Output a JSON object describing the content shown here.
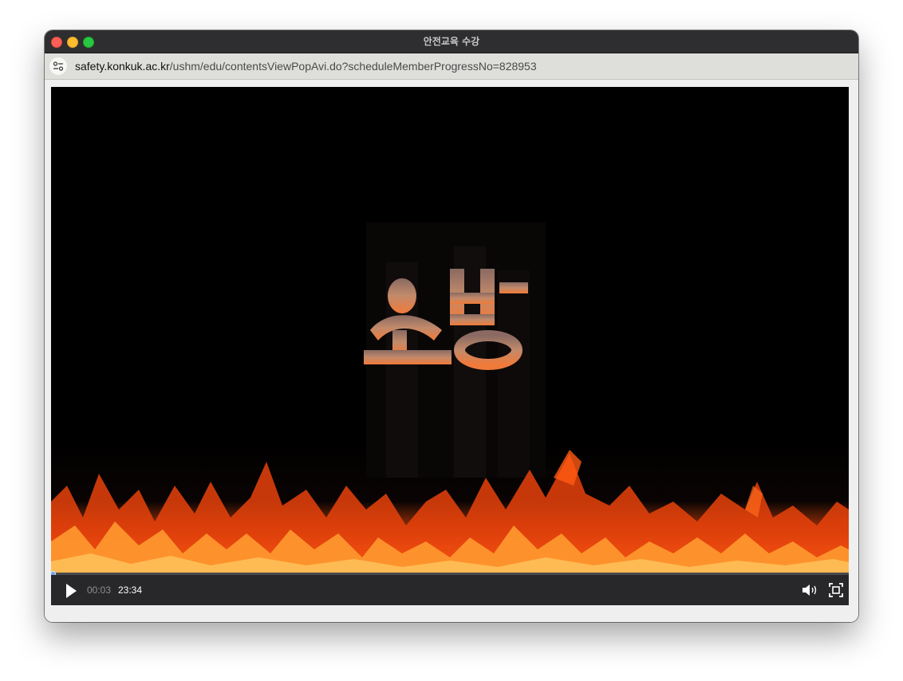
{
  "window": {
    "title": "안전교육 수강"
  },
  "address_bar": {
    "domain": "safety.konkuk.ac.kr",
    "path": "/ushm/edu/contentsViewPopAvi.do?scheduleMemberProgressNo=828953"
  },
  "video": {
    "overlay_text": "소방",
    "current_time": "00:03",
    "duration": "23:34",
    "progress_fraction": 0.002
  },
  "icons": {
    "site_settings": "site-settings-icon",
    "play": "play-icon",
    "volume": "volume-icon",
    "fullscreen": "fullscreen-icon"
  },
  "colors": {
    "titlebar": "#2e2e30",
    "urlbar": "#dededb",
    "controls": "#28282a",
    "progress_accent": "#6fa7e0",
    "flame_orange": "#ff6a1a"
  }
}
